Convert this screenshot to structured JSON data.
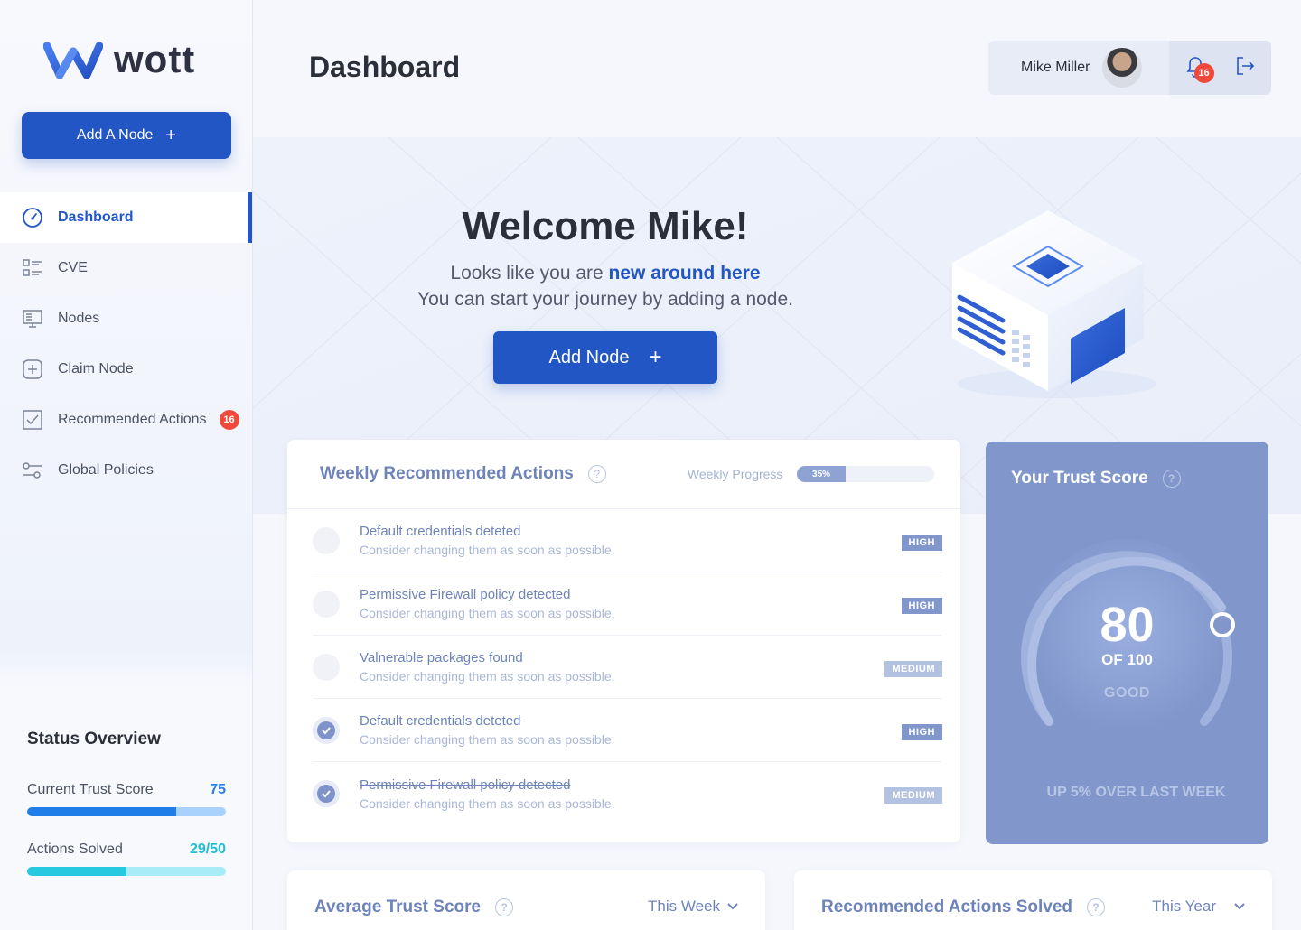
{
  "logo": {
    "text": "wott"
  },
  "sidebar": {
    "add_node_label": "Add A Node",
    "items": [
      {
        "label": "Dashboard",
        "icon": "speedometer-icon"
      },
      {
        "label": "CVE",
        "icon": "list-icon"
      },
      {
        "label": "Nodes",
        "icon": "server-icon"
      },
      {
        "label": "Claim Node",
        "icon": "plus-square-icon"
      },
      {
        "label": "Recommended Actions",
        "icon": "checkbox-icon",
        "badge": "16"
      },
      {
        "label": "Global Policies",
        "icon": "sliders-icon"
      }
    ]
  },
  "status": {
    "title": "Status Overview",
    "trust_label": "Current Trust Score",
    "trust_value": "75",
    "trust_fraction": 0.75,
    "actions_label": "Actions Solved",
    "actions_value": "29/50",
    "actions_fraction": 0.5
  },
  "header": {
    "title": "Dashboard",
    "user_name": "Mike Miller",
    "notification_count": "16"
  },
  "hero": {
    "heading": "Welcome Mike!",
    "line1_prefix": "Looks like you are",
    "line1_highlight": "new around here",
    "line2": "You can start your journey by adding a node.",
    "button_label": "Add Node"
  },
  "weekly": {
    "title": "Weekly Recommended Actions",
    "progress_label": "Weekly Progress",
    "progress_value": "35%",
    "progress_fraction": 0.35,
    "actions": [
      {
        "title": "Default credentials deteted",
        "subtitle": "Consider changing them as soon as possible.",
        "severity": "HIGH",
        "done": false
      },
      {
        "title": "Permissive Firewall policy detected",
        "subtitle": "Consider changing them as soon as possible.",
        "severity": "HIGH",
        "done": false
      },
      {
        "title": "Valnerable packages found",
        "subtitle": "Consider changing them as soon as possible.",
        "severity": "MEDIUM",
        "done": false
      },
      {
        "title": "Default credentials deteted",
        "subtitle": "Consider changing them as soon as possible.",
        "severity": "HIGH",
        "done": true
      },
      {
        "title": "Permissive Firewall policy detected",
        "subtitle": "Consider changing them as soon as possible.",
        "severity": "MEDIUM",
        "done": true
      }
    ]
  },
  "trust": {
    "title": "Your Trust Score",
    "score": "80",
    "of": "OF 100",
    "rating": "GOOD",
    "footer": "UP 5% OVER LAST WEEK"
  },
  "avg_card": {
    "title": "Average Trust Score",
    "period": "This Week"
  },
  "solved_card": {
    "title": "Recommended Actions Solved",
    "period": "This Year"
  },
  "colors": {
    "accent": "#2356c5",
    "badge": "#f0493c",
    "trust_card": "#8197cb"
  }
}
